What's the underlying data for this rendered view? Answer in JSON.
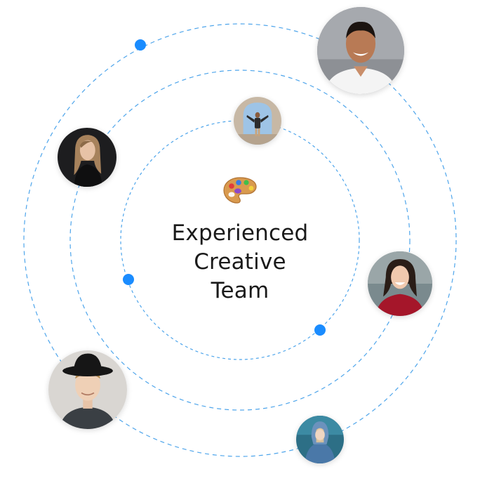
{
  "headline": {
    "line1": "Experienced",
    "line2": "Creative",
    "line3": "Team"
  },
  "icons": {
    "center": "artist-palette-icon"
  },
  "team_members": [
    {
      "avatar": "man-smiling-white-tshirt"
    },
    {
      "avatar": "man-arms-raised-arch"
    },
    {
      "avatar": "woman-dark-hair-black-top"
    },
    {
      "avatar": "woman-laughing-red-sweater"
    },
    {
      "avatar": "man-curly-hair-black-hat"
    },
    {
      "avatar": "woman-denim-hoodie"
    }
  ],
  "colors": {
    "orbit": "#2f95e8",
    "dot": "#1a8cff",
    "text": "#1a1a1a"
  }
}
